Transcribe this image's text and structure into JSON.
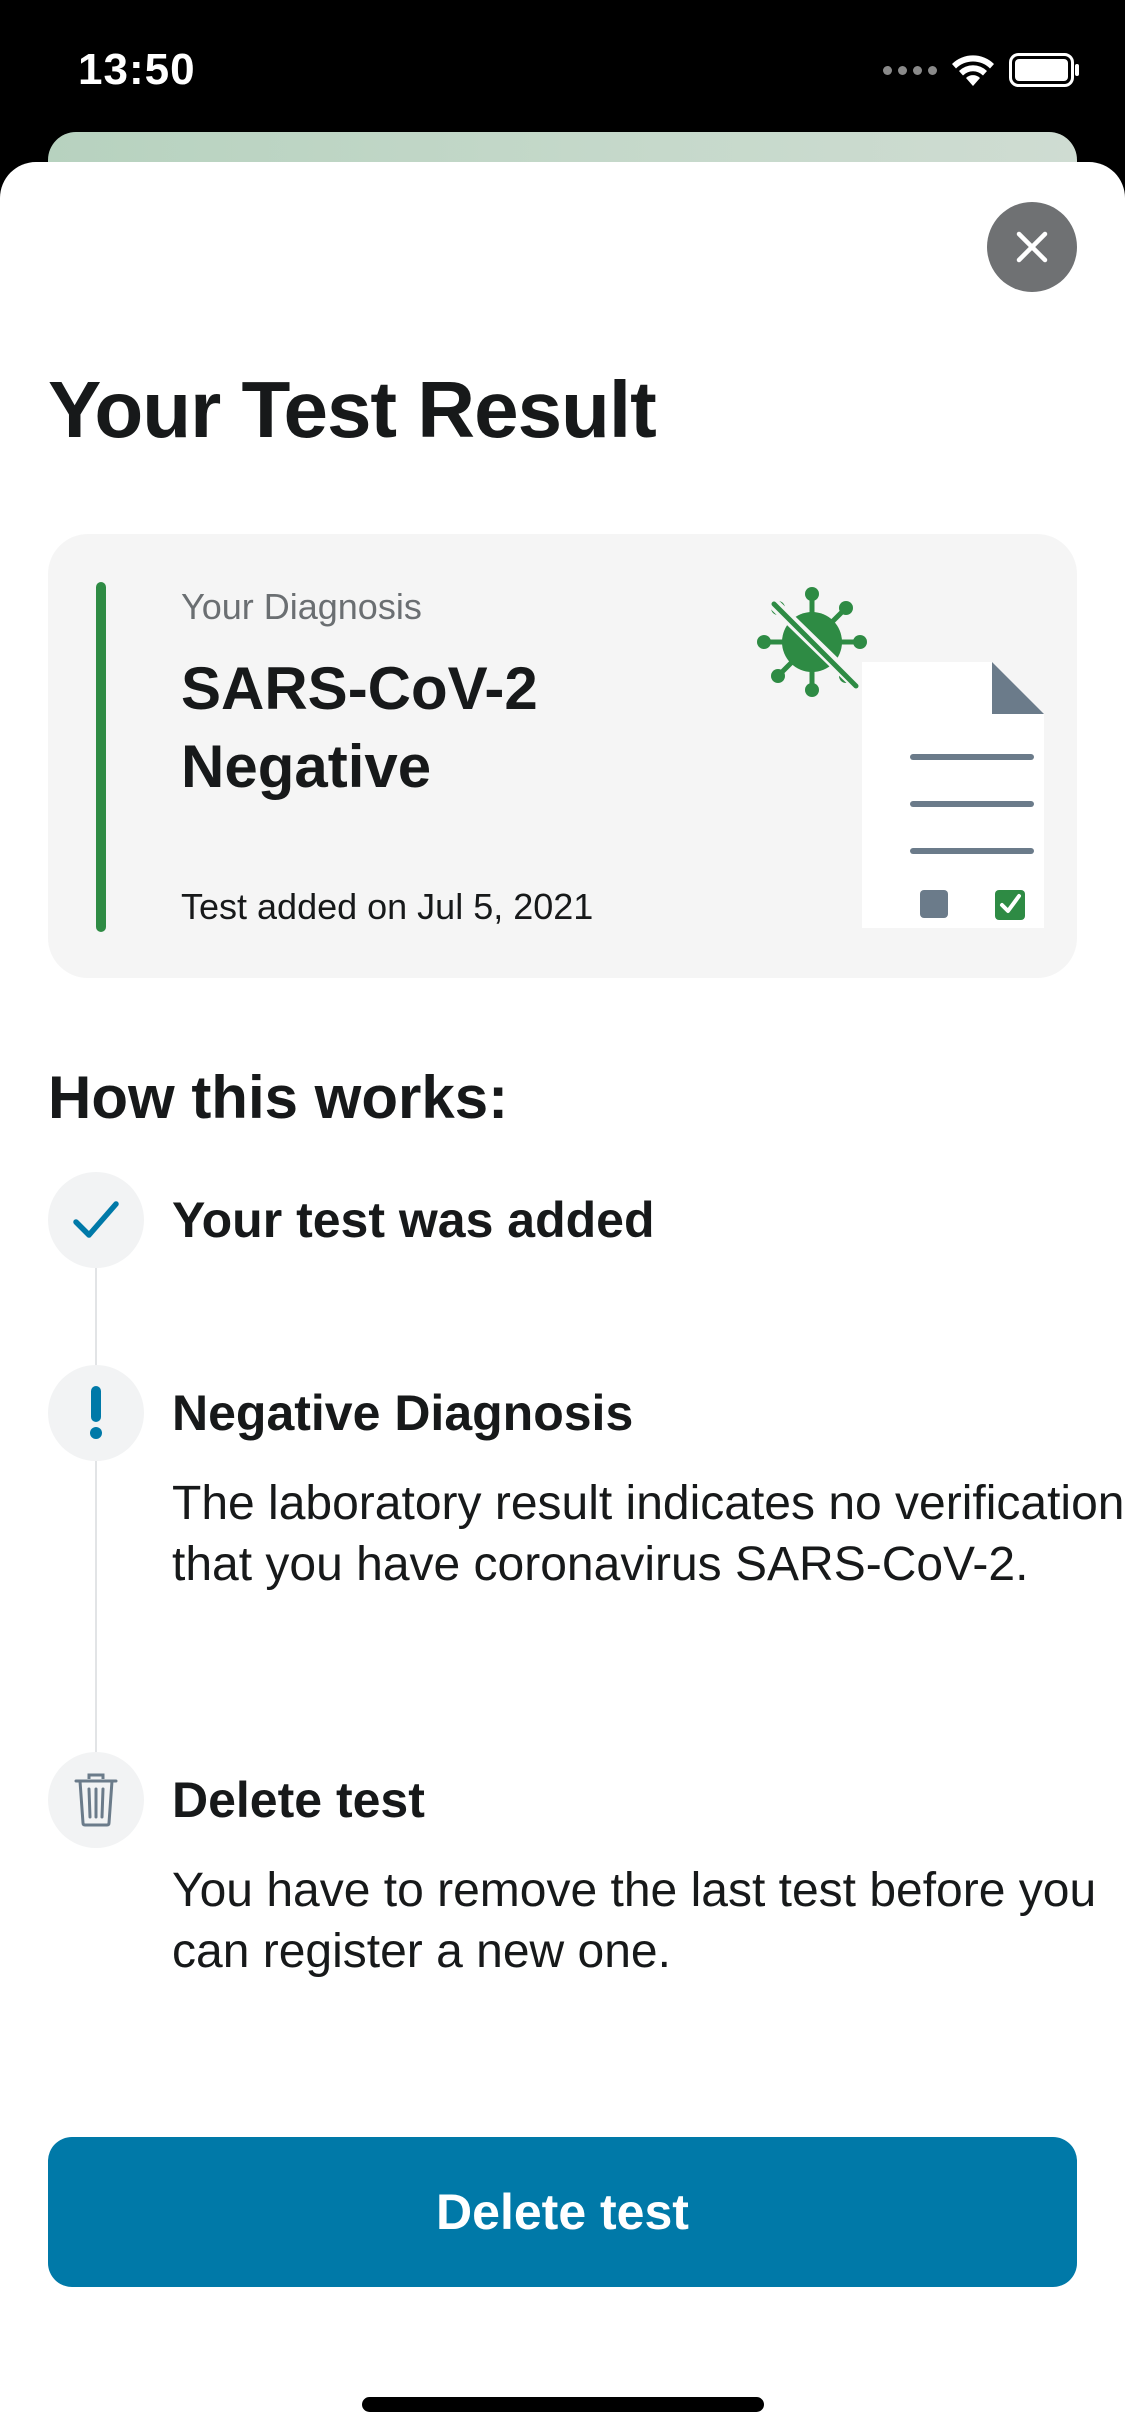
{
  "status_bar": {
    "time": "13:50",
    "icons": [
      "signal-dots-icon",
      "wifi-icon",
      "battery-icon"
    ]
  },
  "sheet": {
    "close_icon": "close-icon",
    "title": "Your Test Result"
  },
  "diagnosis_card": {
    "label": "Your Diagnosis",
    "value": "SARS-CoV-2 Negative",
    "date_text": "Test added on Jul 5, 2021",
    "accent_color": "#2e8b44",
    "illustration": "test-document-illustration"
  },
  "how_it_works": {
    "title": "How this works:",
    "steps": [
      {
        "icon": "checkmark-icon",
        "title": "Your test was added",
        "body": ""
      },
      {
        "icon": "exclamation-icon",
        "title": "Negative Diagnosis",
        "body": "The laboratory result indicates no verification that you have coronavirus SARS-CoV-2."
      },
      {
        "icon": "trash-icon",
        "title": "Delete test",
        "body": "You have to remove the last test before you can register a new one."
      }
    ]
  },
  "primary_button": {
    "label": "Delete test",
    "color": "#0079a8"
  },
  "colors": {
    "brand_blue": "#0079a8",
    "negative_green": "#2e8b44",
    "close_button_gray": "#6f7173"
  }
}
